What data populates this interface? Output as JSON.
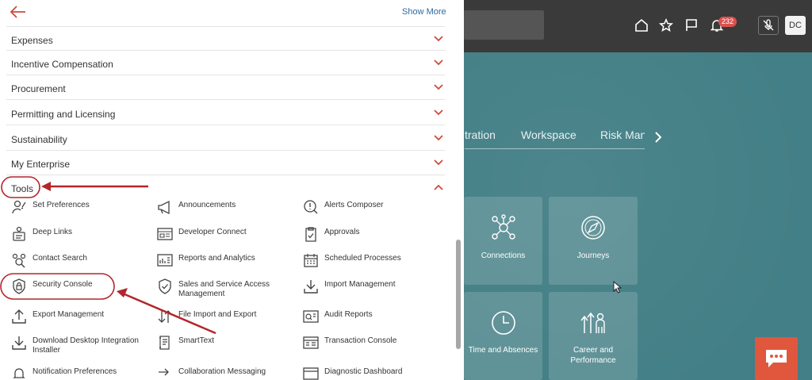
{
  "panel": {
    "show_more": "Show More",
    "categories": [
      {
        "label": "Expenses"
      },
      {
        "label": "Incentive Compensation"
      },
      {
        "label": "Procurement"
      },
      {
        "label": "Permitting and Licensing"
      },
      {
        "label": "Sustainability"
      },
      {
        "label": "My Enterprise"
      }
    ],
    "tools_label": "Tools",
    "tools": [
      {
        "label": "Set Preferences",
        "icon": "user-settings-icon"
      },
      {
        "label": "Announcements",
        "icon": "megaphone-icon"
      },
      {
        "label": "Alerts Composer",
        "icon": "alert-icon"
      },
      {
        "label": "Deep Links",
        "icon": "deep-links-icon"
      },
      {
        "label": "Developer Connect",
        "icon": "developer-icon"
      },
      {
        "label": "Approvals",
        "icon": "clipboard-check-icon"
      },
      {
        "label": "Contact Search",
        "icon": "contact-search-icon"
      },
      {
        "label": "Reports and Analytics",
        "icon": "report-icon"
      },
      {
        "label": "Scheduled Processes",
        "icon": "calendar-icon"
      },
      {
        "label": "Security Console",
        "icon": "shield-lock-icon"
      },
      {
        "label": "Sales and Service Access Management",
        "icon": "shield-check-icon"
      },
      {
        "label": "Import Management",
        "icon": "import-icon"
      },
      {
        "label": "Export Management",
        "icon": "export-icon"
      },
      {
        "label": "File Import and Export",
        "icon": "file-transfer-icon"
      },
      {
        "label": "Audit Reports",
        "icon": "audit-icon"
      },
      {
        "label": "Download Desktop Integration Installer",
        "icon": "download-icon"
      },
      {
        "label": "SmartText",
        "icon": "smarttext-icon"
      },
      {
        "label": "Transaction Console",
        "icon": "console-icon"
      },
      {
        "label": "Notification Preferences",
        "icon": "notification-icon"
      },
      {
        "label": "Collaboration Messaging",
        "icon": "messaging-icon"
      },
      {
        "label": "Diagnostic Dashboard",
        "icon": "dashboard-icon"
      }
    ]
  },
  "header": {
    "notification_count": "232",
    "avatar_initials": "DC"
  },
  "nav_tabs": [
    {
      "label": "tration"
    },
    {
      "label": "Workspace"
    },
    {
      "label": "Risk Mana"
    }
  ],
  "tiles": [
    {
      "label": "Connections"
    },
    {
      "label": "Journeys"
    },
    {
      "label": "Time and Absences"
    },
    {
      "label": "Career and Performance"
    }
  ],
  "colors": {
    "accent_red": "#d14a3c",
    "annotation_red": "#b3262b",
    "link_blue": "#2c6aa0",
    "header_bg": "#3a3a3a",
    "teal_bg": "#437f86",
    "chat_orange": "#e0573e"
  }
}
